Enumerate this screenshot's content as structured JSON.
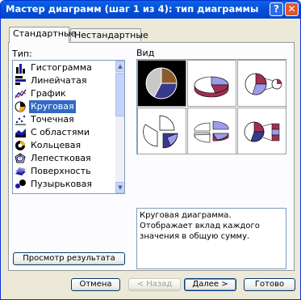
{
  "window": {
    "title": "Мастер диаграмм (шаг 1 из 4): тип диаграммы",
    "help_glyph": "?",
    "close_glyph": "✕"
  },
  "tabs": [
    {
      "label": "Стандартные",
      "active": true
    },
    {
      "label": "Нестандартные",
      "active": false
    }
  ],
  "type_label": "Тип:",
  "view_label": "Вид",
  "chart_types": [
    {
      "label": "Гистограмма",
      "icon": "column-chart-icon"
    },
    {
      "label": "Линейчатая",
      "icon": "bar-chart-icon"
    },
    {
      "label": "График",
      "icon": "line-chart-icon"
    },
    {
      "label": "Круговая",
      "icon": "pie-chart-icon",
      "selected": true
    },
    {
      "label": "Точечная",
      "icon": "scatter-chart-icon"
    },
    {
      "label": "С областями",
      "icon": "area-chart-icon"
    },
    {
      "label": "Кольцевая",
      "icon": "doughnut-chart-icon"
    },
    {
      "label": "Лепестковая",
      "icon": "radar-chart-icon"
    },
    {
      "label": "Поверхность",
      "icon": "surface-chart-icon"
    },
    {
      "label": "Пузырьковая",
      "icon": "bubble-chart-icon"
    }
  ],
  "subtype_icons": [
    "pie-icon",
    "pie-3d-icon",
    "pie-of-pie-icon",
    "exploded-pie-icon",
    "exploded-pie-3d-icon",
    "bar-of-pie-icon"
  ],
  "description": "Круговая диаграмма. Отображает вклад каждого значения в общую сумму.",
  "preview_button": "Просмотр результата",
  "buttons": {
    "cancel": "Отмена",
    "back": "< Назад",
    "next": "Далее >",
    "finish": "Готово"
  },
  "colors": {
    "pie_brown": "#8b5a2b",
    "pie_gray": "#c8c8c8",
    "pie_navy": "#3a3a8c",
    "pie_lavender": "#9c9ce8",
    "pie_maroon": "#a03050",
    "selection": "#316ac5"
  }
}
